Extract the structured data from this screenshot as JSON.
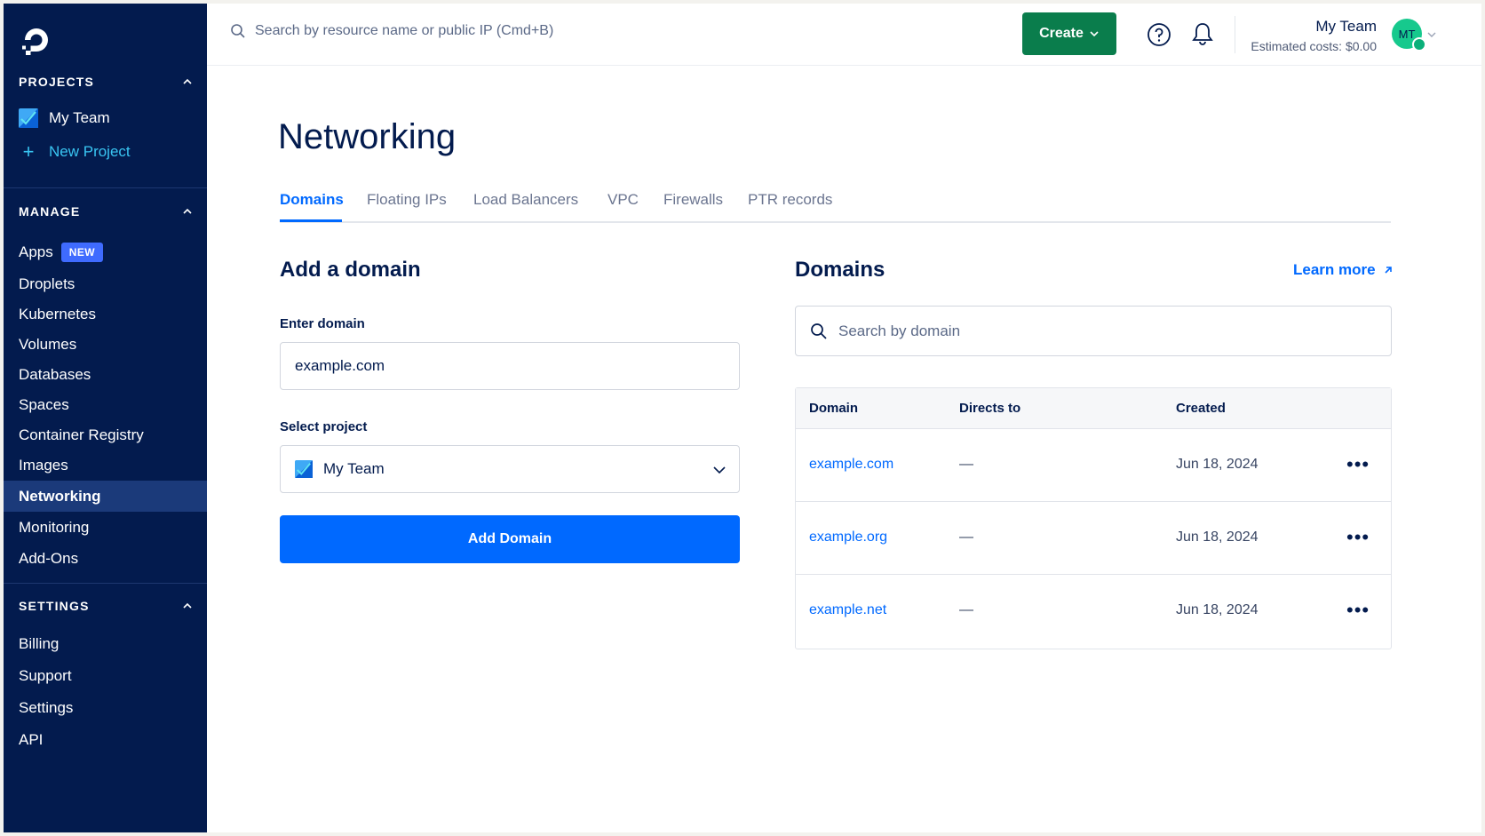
{
  "sidebar": {
    "projects_heading": "PROJECTS",
    "project_name": "My Team",
    "new_project": "New Project",
    "manage_heading": "MANAGE",
    "nav": [
      {
        "label": "Apps",
        "badge": "NEW"
      },
      {
        "label": "Droplets"
      },
      {
        "label": "Kubernetes"
      },
      {
        "label": "Volumes"
      },
      {
        "label": "Databases"
      },
      {
        "label": "Spaces"
      },
      {
        "label": "Container Registry"
      },
      {
        "label": "Images"
      },
      {
        "label": "Networking",
        "active": true
      },
      {
        "label": "Monitoring"
      },
      {
        "label": "Add-Ons"
      }
    ],
    "settings_heading": "SETTINGS",
    "settings_nav": [
      "Billing",
      "Support",
      "Settings",
      "API"
    ]
  },
  "topbar": {
    "search_placeholder": "Search by resource name or public IP (Cmd+B)",
    "create_label": "Create",
    "team_name": "My Team",
    "estimated_costs": "Estimated costs: $0.00",
    "avatar_initials": "MT"
  },
  "page": {
    "title": "Networking",
    "tabs": [
      "Domains",
      "Floating IPs",
      "Load Balancers",
      "VPC",
      "Firewalls",
      "PTR records"
    ],
    "active_tab": "Domains"
  },
  "add_domain": {
    "heading": "Add a domain",
    "enter_label": "Enter domain",
    "enter_value": "example.com",
    "project_label": "Select project",
    "project_value": "My Team",
    "button": "Add Domain"
  },
  "domains": {
    "heading": "Domains",
    "learn_more": "Learn more",
    "search_placeholder": "Search by domain",
    "columns": [
      "Domain",
      "Directs to",
      "Created"
    ],
    "rows": [
      {
        "domain": "example.com",
        "directs_to": "—",
        "created": "Jun 18, 2024"
      },
      {
        "domain": "example.org",
        "directs_to": "—",
        "created": "Jun 18, 2024"
      },
      {
        "domain": "example.net",
        "directs_to": "—",
        "created": "Jun 18, 2024"
      }
    ]
  },
  "colors": {
    "sidebar_bg": "#031b4e",
    "accent": "#0069ff",
    "create_green": "#0a7d4c"
  }
}
